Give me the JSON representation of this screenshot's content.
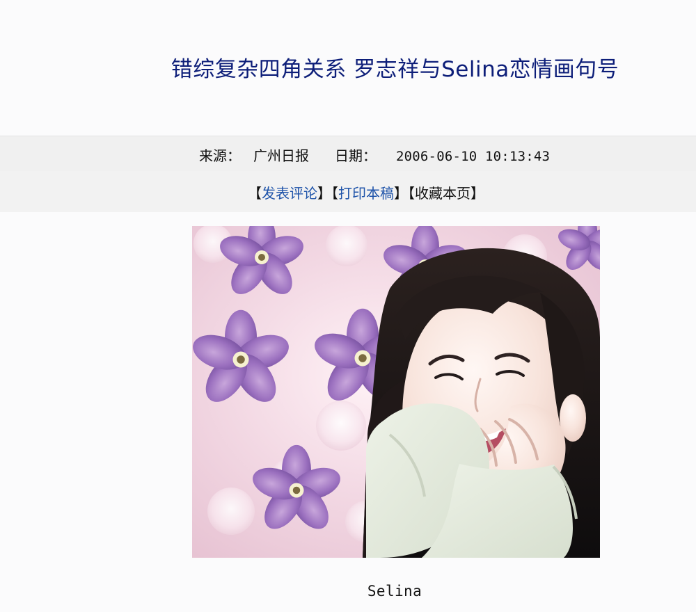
{
  "article": {
    "title": "错综复杂四角关系 罗志祥与Selina恋情画句号",
    "source_label": "来源：",
    "source_value": "广州日报",
    "date_label": "日期：",
    "date_value": "2006-06-10 10:13:43",
    "caption": "Selina"
  },
  "actions": {
    "open_bracket": "【",
    "close_bracket": "】",
    "comment": "发表评论",
    "print": "打印本稿",
    "favorite": "收藏本页"
  },
  "colors": {
    "title": "#0d1e79",
    "link": "#1e53a9"
  },
  "image": {
    "subject": "woman-smiling-with-flower-background"
  }
}
